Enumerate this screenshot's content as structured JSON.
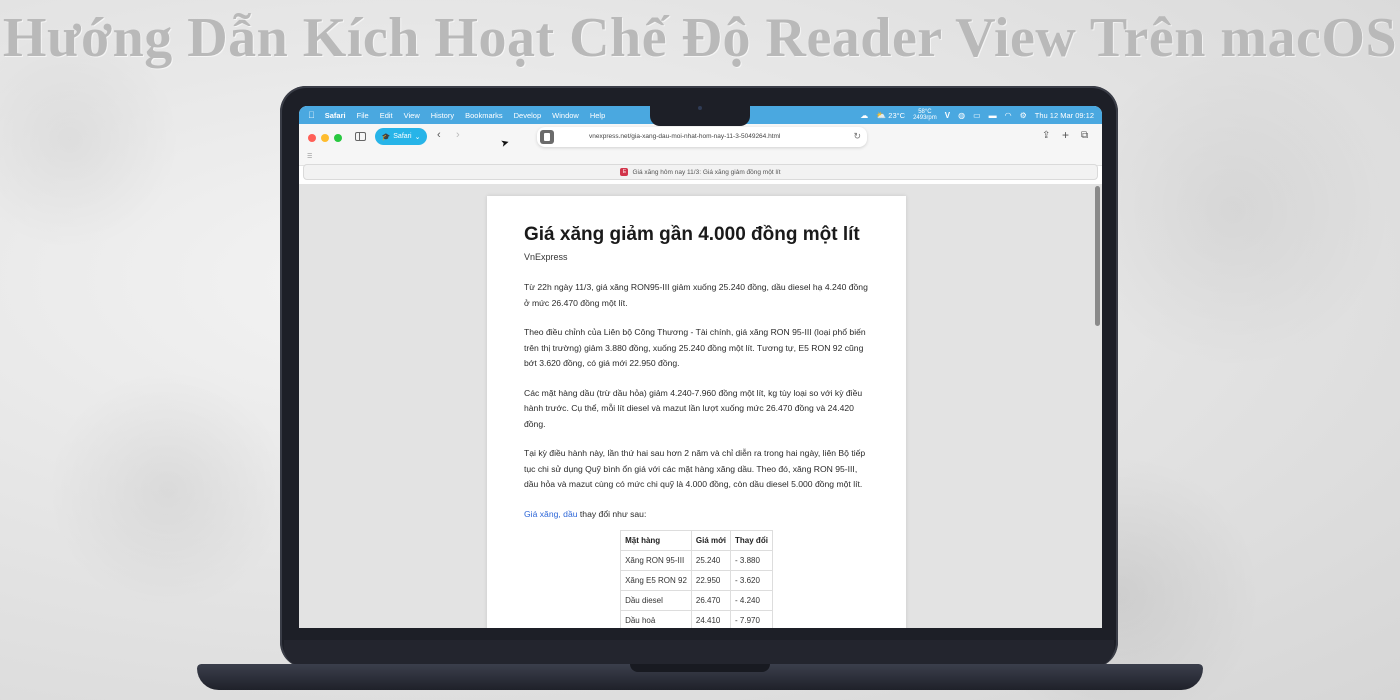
{
  "headline": "Hướng Dẫn Kích Hoạt Chế Độ Reader View Trên macOS",
  "menubar": {
    "apple_icon": "apple-icon",
    "app_name": "Safari",
    "items": [
      "File",
      "Edit",
      "View",
      "History",
      "Bookmarks",
      "Develop",
      "Window",
      "Help"
    ],
    "weather_temp": "23°C",
    "cpu_temp": "58°C",
    "fan_speed": "2493rpm",
    "datetime": "Thu 12 Mar 09:12"
  },
  "toolbar": {
    "profile_label": "Safari",
    "url": "vnexpress.net/gia-xang-dau-moi-nhat-hom-nay-11-3-5049264.html"
  },
  "tab": {
    "title": "Giá xăng hôm nay 11/3: Giá xăng giảm đồng một lít",
    "favicon_letter": "E"
  },
  "article": {
    "title": "Giá xăng giảm gần 4.000 đồng một lít",
    "source": "VnExpress",
    "p1": "Từ 22h ngày 11/3, giá xăng RON95-III giảm xuống 25.240 đồng, dầu diesel hạ 4.240 đồng ở mức 26.470 đồng một lít.",
    "p2": "Theo điều chỉnh của Liên bộ Công Thương - Tài chính, giá xăng RON 95-III (loại phổ biến trên thị trường) giảm 3.880 đồng, xuống 25.240 đồng một lít. Tương tự, E5 RON 92 cũng bớt 3.620 đồng, có giá mới 22.950 đồng.",
    "p3": "Các mặt hàng dầu (trừ dầu hỏa) giảm 4.240-7.960 đồng một lít, kg tùy loại so với kỳ điều hành trước. Cụ thể, mỗi lít diesel và mazut lần lượt xuống mức 26.470 đồng và 24.420 đồng.",
    "p4": "Tại kỳ điều hành này, lần thứ hai sau hơn 2 năm và chỉ diễn ra trong hai ngày, liên Bộ tiếp tục chi sử dụng Quỹ bình ổn giá với các mặt hàng xăng dầu. Theo đó, xăng RON 95-III, dầu hỏa và mazut cùng có mức chi quỹ là 4.000 đồng, còn dầu diesel 5.000 đồng một lít.",
    "p5_link": "Giá xăng, dầu",
    "p5_rest": " thay đổi như sau:",
    "table": {
      "headers": [
        "Mặt hàng",
        "Giá mới",
        "Thay đổi"
      ],
      "rows": [
        [
          "Xăng RON 95-III",
          "25.240",
          "- 3.880"
        ],
        [
          "Xăng E5 RON 92",
          "22.950",
          "- 3.620"
        ],
        [
          "Dầu diesel",
          "26.470",
          "- 4.240"
        ],
        [
          "Dầu hoả",
          "24.410",
          "- 7.970"
        ]
      ]
    }
  }
}
